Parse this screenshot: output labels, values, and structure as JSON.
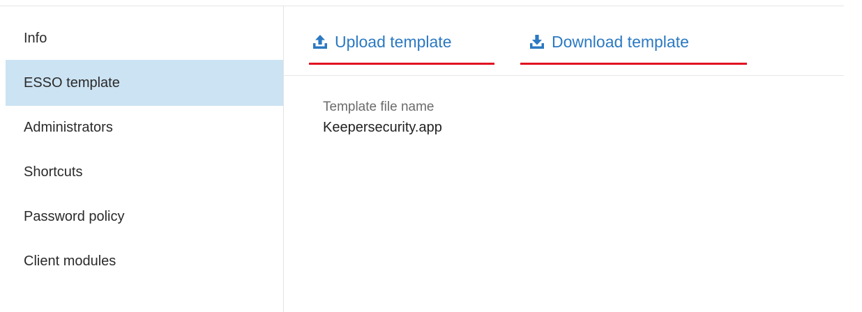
{
  "sidebar": {
    "items": [
      {
        "label": "Info",
        "active": false
      },
      {
        "label": "ESSO template",
        "active": true
      },
      {
        "label": "Administrators",
        "active": false
      },
      {
        "label": "Shortcuts",
        "active": false
      },
      {
        "label": "Password policy",
        "active": false
      },
      {
        "label": "Client modules",
        "active": false
      }
    ]
  },
  "toolbar": {
    "upload_label": "Upload template",
    "download_label": "Download template",
    "upload_icon": "upload-icon",
    "download_icon": "download-icon"
  },
  "template": {
    "file_name_label": "Template file name",
    "file_name_value": "Keepersecurity.app"
  },
  "colors": {
    "accent": "#2b79c2",
    "active_bg": "#cce3f3",
    "highlight_underline": "#e01020"
  }
}
